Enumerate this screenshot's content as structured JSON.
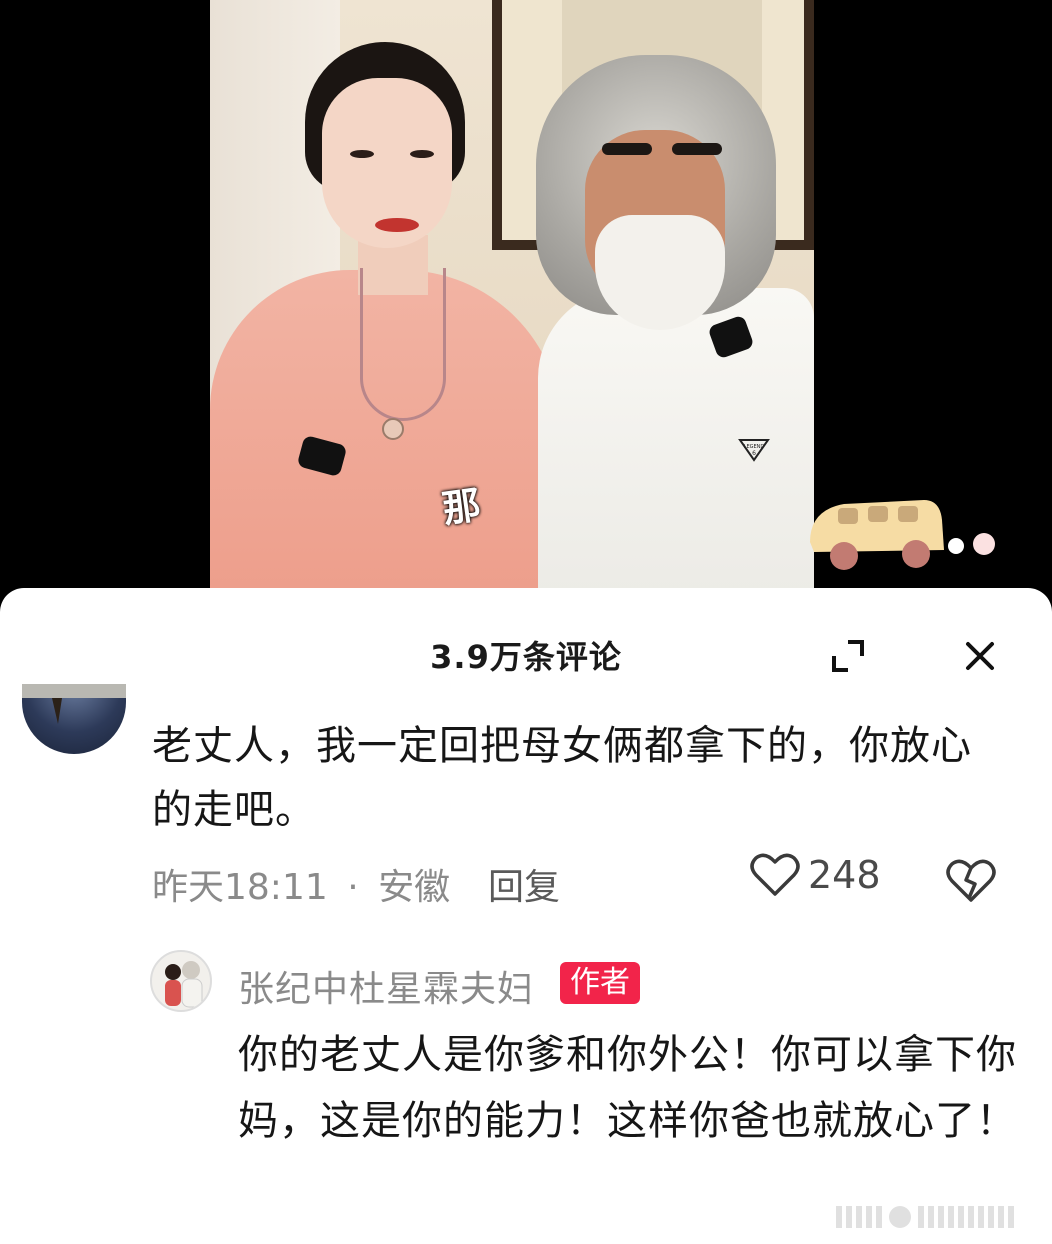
{
  "video": {
    "overlay_char": "那",
    "shirt_logo": "LEGEND 6"
  },
  "sheet": {
    "title": "3.9万条评论",
    "expand_icon": "expand-icon",
    "close_icon": "close-icon"
  },
  "comment": {
    "text": "老丈人，我一定回把母女俩都拿下的，你放心的走吧。",
    "time": "昨天18:11",
    "separator": "·",
    "location": "安徽",
    "reply_label": "回复",
    "like_count": "248",
    "like_icon": "heart-icon",
    "dislike_icon": "broken-heart-icon"
  },
  "reply": {
    "author": "张纪中杜星霖夫妇",
    "badge": "作者",
    "text": "你的老丈人是你爹和你外公！你可以拿下你妈，这是你的能力！这样你爸也就放心了！"
  },
  "colors": {
    "badge": "#f2244a",
    "meta_text": "#8a8a8a",
    "body_text": "#161616"
  }
}
